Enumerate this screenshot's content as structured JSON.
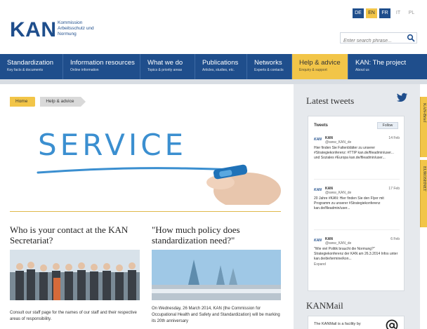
{
  "header": {
    "logo": "KAN",
    "logo_sub": [
      "Kommission",
      "Arbeitsschutz und",
      "Normung"
    ],
    "languages": [
      {
        "code": "DE",
        "state": "blue"
      },
      {
        "code": "EN",
        "state": "active-yellow"
      },
      {
        "code": "FR",
        "state": "blue"
      },
      {
        "code": "IT",
        "state": "plain"
      },
      {
        "code": "PL",
        "state": "plain"
      }
    ],
    "search_placeholder": "Enter search phrase..."
  },
  "nav": [
    {
      "title": "Standardization",
      "sub": "Key facts & documents",
      "active": false
    },
    {
      "title": "Information resources",
      "sub": "Online information",
      "active": false
    },
    {
      "title": "What we do",
      "sub": "Topics & priority areas",
      "active": false
    },
    {
      "title": "Publications",
      "sub": "Articles, studies, etc.",
      "active": false
    },
    {
      "title": "Networks",
      "sub": "Experts & contacts",
      "active": false
    },
    {
      "title": "Help & advice",
      "sub": "Enquiry & support",
      "active": true
    },
    {
      "title": "KAN: The project",
      "sub": "About us",
      "active": false
    }
  ],
  "breadcrumb": {
    "home": "Home",
    "current": "Help & advice"
  },
  "hero": {
    "word": "SERVICE"
  },
  "columns": [
    {
      "heading": "Who is your contact at the KAN Secretariat?",
      "text": "Consult our staff page for the names of our staff and their respective areas of responsibility."
    },
    {
      "heading": "\"How much policy does standardization need?\"",
      "text": "On Wednesday, 26 March 2014, KAN (the Commission for Occupational Health and Safety and Standardization) will be marking its 20th anniversary"
    }
  ],
  "sidebar": {
    "latest_tweets": "Latest tweets",
    "tweets_label": "Tweets",
    "follow_label": "Follow",
    "tweets": [
      {
        "name": "KAN",
        "handle": "@www_KAN_de",
        "date": "14 Feb",
        "body": "Hier finden Sie Faltenblätter zu unserer #Strategiekonferenz: #TTIP kan.de/fileadmin/user... und Soziales #Europa kan.de/fileadmin/user..."
      },
      {
        "name": "KAN",
        "handle": "@www_KAN_de",
        "date": "17 Feb",
        "body": "20 Jahre #KAN: Hier finden Sie den Flyer mit Programm zu unserer #Strategiekonferenz kan.de/fileadmin/user..."
      },
      {
        "name": "KAN",
        "handle": "@www_KAN_de",
        "date": "6 Feb",
        "body": "\"Wie viel Politik braucht die Normung?\" Strategiekonferenz der KAN am 26.3.2014 Infos unter kan.de/de/termine/kon...",
        "expand": "Expand"
      }
    ],
    "kanmail_heading": "KANMail",
    "kanmail_text": "The KANMail is a facility by"
  },
  "side_tabs": [
    "KAN-Brief",
    "EUROSHNET"
  ],
  "colors": {
    "brand_blue": "#1f4e8c",
    "accent_yellow": "#f2c548",
    "service_blue": "#3b8fd0"
  }
}
